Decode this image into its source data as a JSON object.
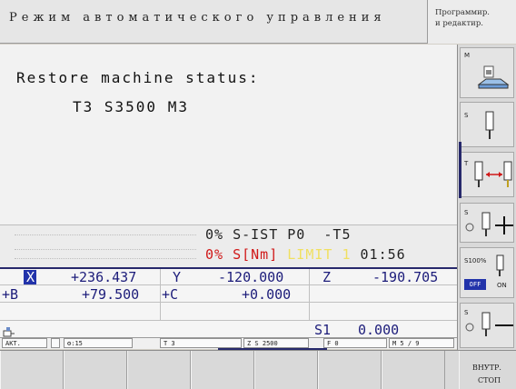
{
  "header": {
    "title": "Режим автоматического управления",
    "mode_line1": "Программир.",
    "mode_line2": "и редактир."
  },
  "main": {
    "restore_label": "Restore machine status:",
    "restore_values": "T3 S3500 M3"
  },
  "spindle": {
    "line1": "0% S-IST P0  -T5",
    "line2_pct": "0% S[Nm]",
    "line2_limit": "LIMIT 1",
    "time": "01:56"
  },
  "positions": {
    "x_label": "X",
    "x_value": "+236.437",
    "y_label": "Y",
    "y_value": "-120.000",
    "z_label": "Z",
    "z_value": "-190.705",
    "b_label": "B",
    "b_value": "+79.500",
    "c_label": "C",
    "c_value": "+0.000",
    "s1_label": "S1",
    "s1_value": "0.000"
  },
  "status_bar": {
    "akt": "AKT.",
    "feed_override": "15",
    "tool": "T 3",
    "spindle": "Z S 2500",
    "feed": "F 0",
    "misc": "M 5 / 9"
  },
  "side_keys": {
    "k1": "M",
    "k2": "S",
    "k3": "T",
    "k4": "S",
    "k5_pct": "S100%",
    "k5_off": "OFF",
    "k5_on": "ON",
    "k6": "S"
  },
  "bottom_keys": {
    "internal_stop_line1": "ВНУТР.",
    "internal_stop_line2": "СТОП"
  },
  "colors": {
    "axis_text": "#1c1c7a",
    "limit": "#f0e060",
    "alarm": "#d01818",
    "accent": "#27296b"
  }
}
